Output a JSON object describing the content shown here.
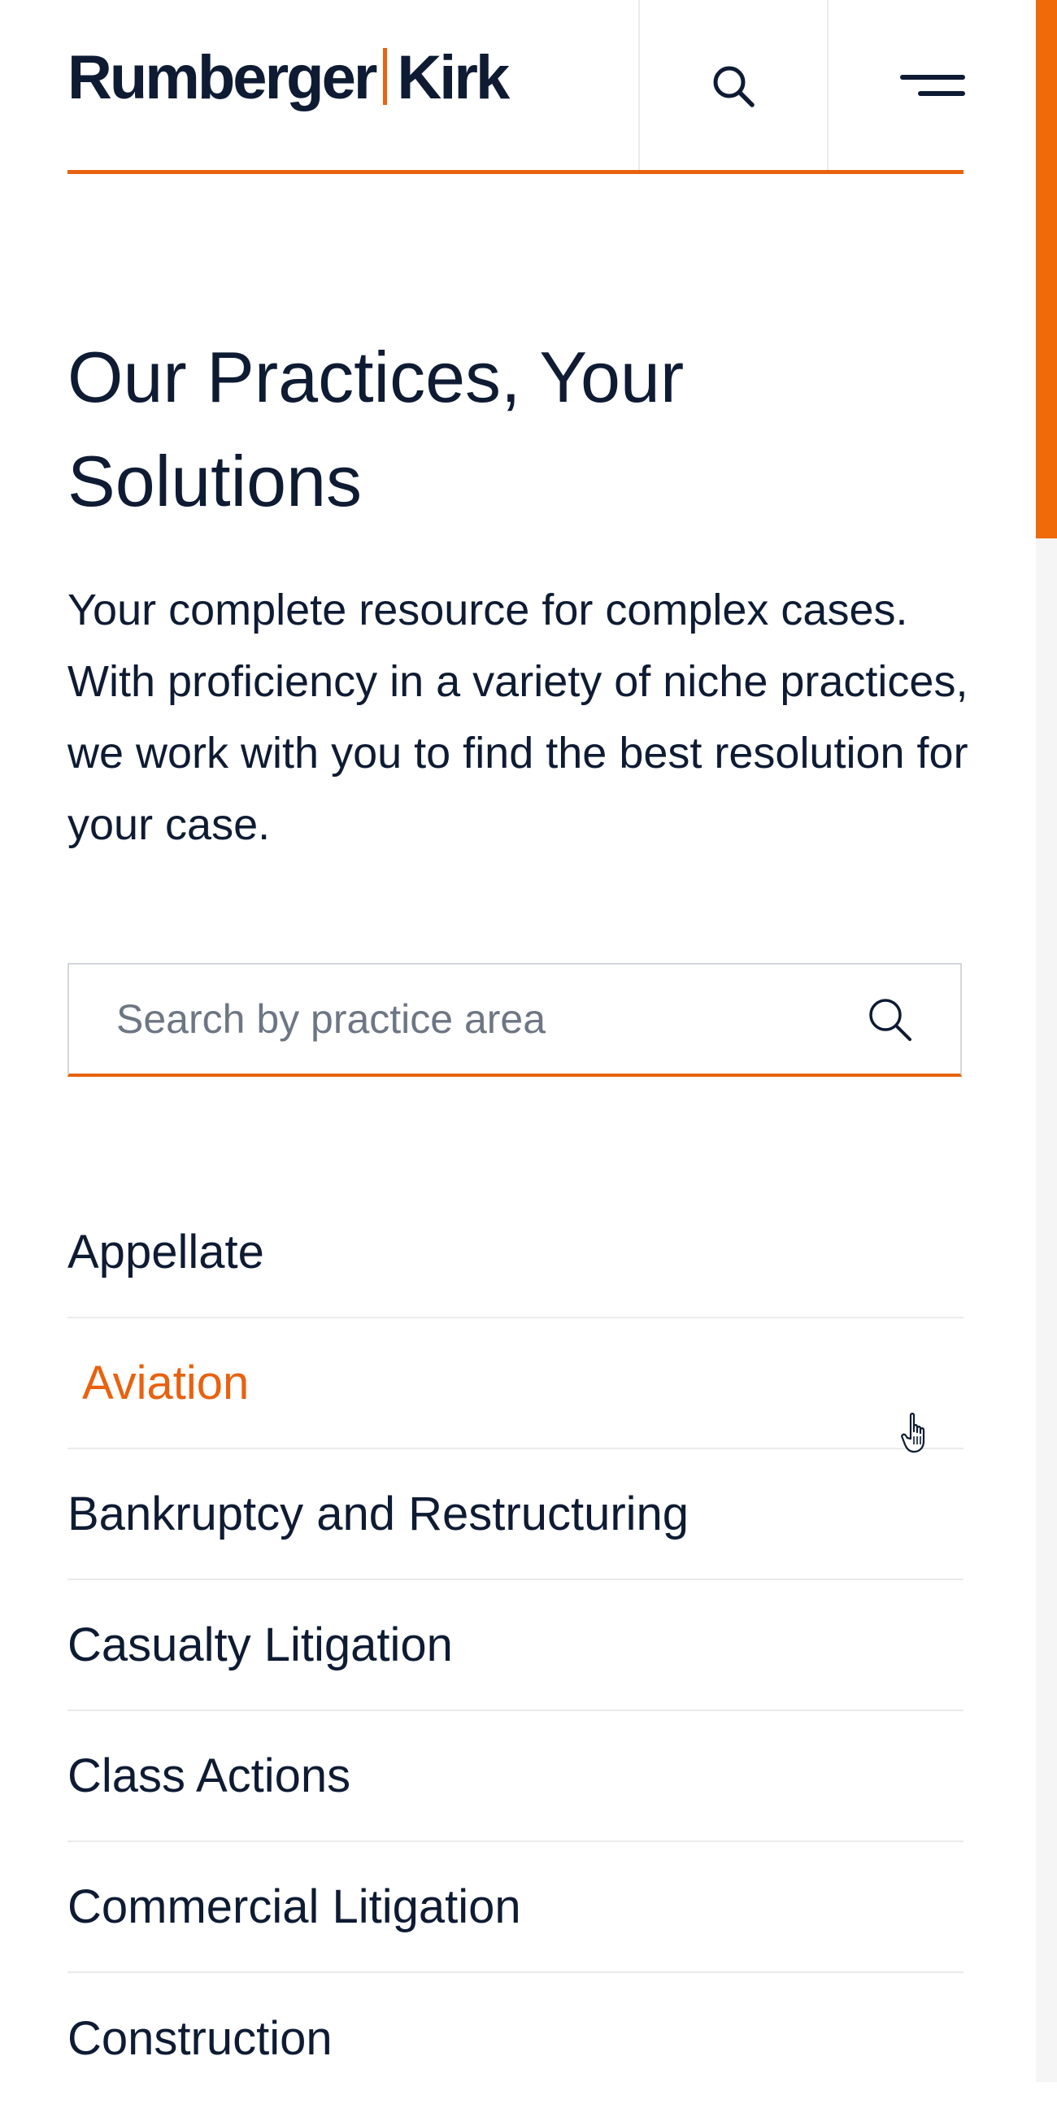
{
  "header": {
    "logo_left": "Rumberger",
    "logo_right": "Kirk",
    "search_icon": "search-icon",
    "menu_icon": "hamburger-menu-icon",
    "accent_color": "#e8620f",
    "text_color": "#0e1b33"
  },
  "main": {
    "title": "Our Practices, Your Solutions",
    "intro": "Your complete resource for complex cases. With proficiency in a variety of niche practices, we work with you to find the best resolution for your case.",
    "search": {
      "placeholder": "Search by practice area",
      "value": "",
      "icon": "search-icon"
    },
    "practices": [
      {
        "label": "Appellate"
      },
      {
        "label": "Aviation",
        "hovered": true
      },
      {
        "label": "Bankruptcy and Restructuring"
      },
      {
        "label": "Casualty Litigation"
      },
      {
        "label": "Class Actions"
      },
      {
        "label": "Commercial Litigation"
      },
      {
        "label": "Construction"
      }
    ]
  },
  "scrollbar": {
    "thumb_color": "#f06a0a"
  }
}
